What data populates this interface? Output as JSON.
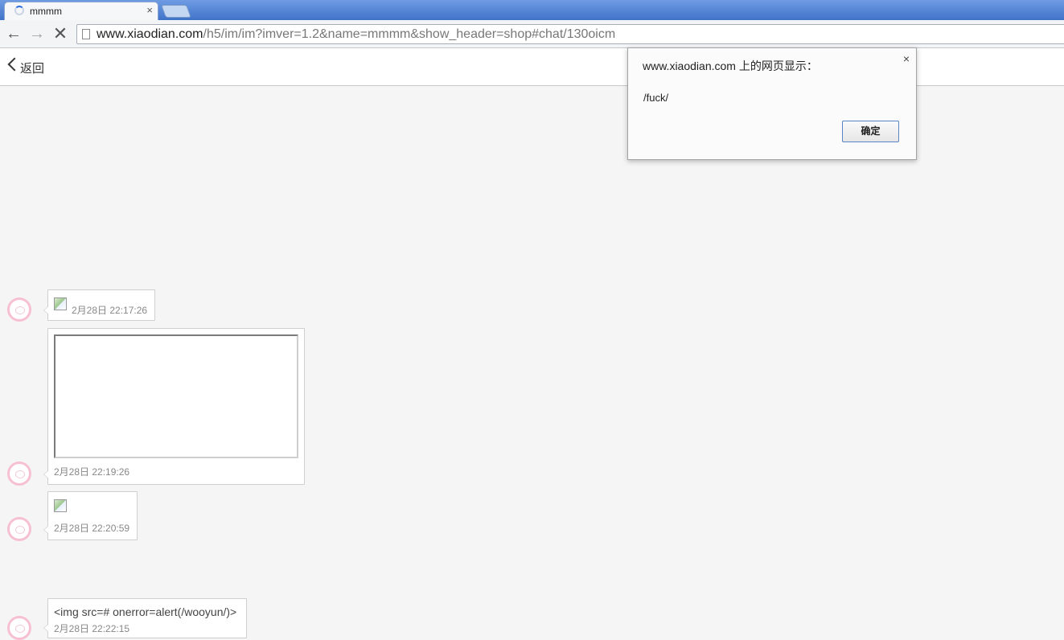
{
  "browser": {
    "tab": {
      "title": "mmmm",
      "close": "×"
    },
    "address": {
      "host": "www.xiaodian.com",
      "path": "/h5/im/im?imver=1.2&name=mmmm&show_header=shop#chat/130oicm"
    },
    "nav": {
      "back": "🡐",
      "forward": "🡒",
      "stop": "✕"
    }
  },
  "page": {
    "back_label": "返回"
  },
  "messages": [
    {
      "type": "image",
      "time": "2月28日 22:17:26"
    },
    {
      "type": "iframe",
      "time": "2月28日 22:19:26"
    },
    {
      "type": "image",
      "time": "2月28日 22:20:59"
    },
    {
      "type": "text",
      "text": "<img src=# onerror=alert(/wooyun/)>",
      "time": "2月28日 22:22:15"
    }
  ],
  "dialog": {
    "title": "www.xiaodian.com 上的网页显示：",
    "message": "/fuck/",
    "ok_label": "确定",
    "close": "×"
  }
}
